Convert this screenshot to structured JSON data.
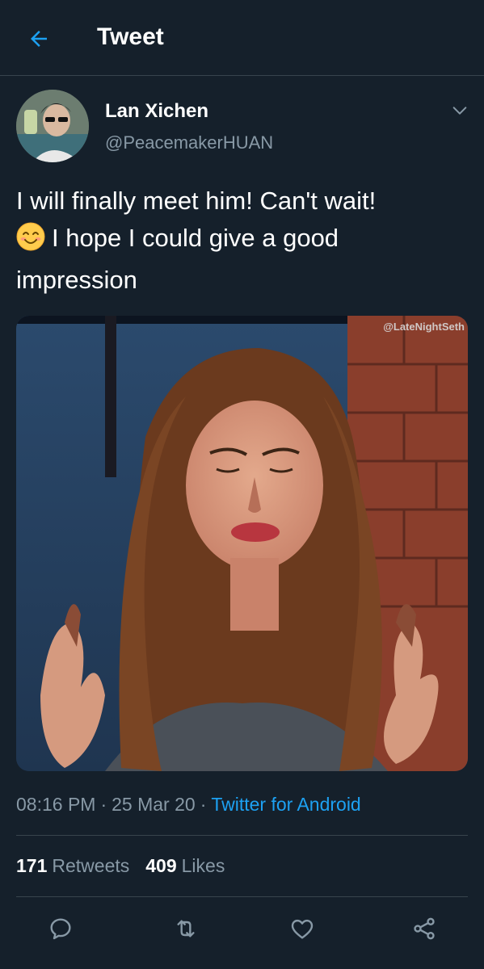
{
  "header": {
    "title": "Tweet",
    "back_icon": "arrow-left-icon"
  },
  "author": {
    "name": "Lan Xichen",
    "handle": "@PeacemakerHUAN"
  },
  "tweet": {
    "lines": [
      "I will finally meet him! Can't wait!",
      "I hope I could give a good",
      "impression"
    ],
    "emoji": "😊",
    "media_watermark": "@LateNightSeth"
  },
  "meta": {
    "time": "08:16 PM",
    "date": "25 Mar 20",
    "separator": "·",
    "source": "Twitter for Android"
  },
  "stats": {
    "retweets_count": "171",
    "retweets_label": "Retweets",
    "likes_count": "409",
    "likes_label": "Likes"
  },
  "actions": [
    "reply-icon",
    "retweet-icon",
    "like-icon",
    "share-icon"
  ],
  "colors": {
    "background": "#15202b",
    "accent": "#1da1f2",
    "secondary_text": "#8899a6",
    "divider": "#38444d"
  }
}
